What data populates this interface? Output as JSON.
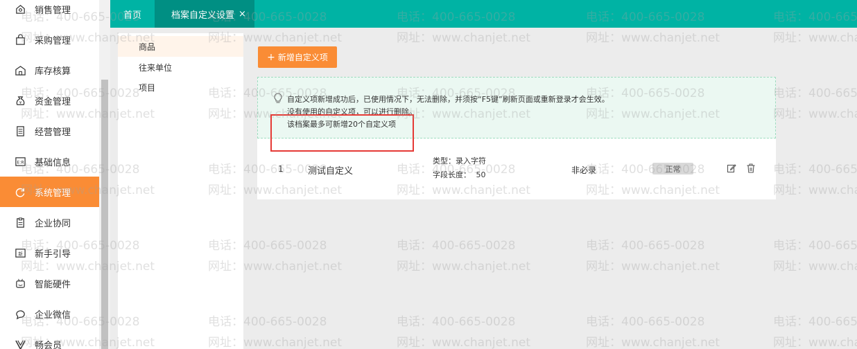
{
  "nav": {
    "items": [
      {
        "label": "销售管理",
        "icon": "sales-icon"
      },
      {
        "label": "采购管理",
        "icon": "purchase-bag-icon"
      },
      {
        "label": "库存核算",
        "icon": "warehouse-icon"
      },
      {
        "label": "资金管理",
        "icon": "money-bag-icon"
      },
      {
        "label": "经营管理",
        "icon": "document-list-icon"
      },
      {
        "label": "基础信息",
        "icon": "info-card-icon"
      },
      {
        "label": "系统管理",
        "icon": "system-refresh-icon"
      },
      {
        "label": "企业协同",
        "icon": "clipboard-icon"
      },
      {
        "label": "新手引导",
        "icon": "new-guide-icon"
      },
      {
        "label": "智能硬件",
        "icon": "robot-icon"
      },
      {
        "label": "企业微信",
        "icon": "chat-bubble-icon"
      },
      {
        "label": "畅会员",
        "icon": "member-v-icon"
      }
    ],
    "active_index": 6,
    "active_color": "#fa8c35"
  },
  "topbar": {
    "color": "#00b3a4",
    "tabs": [
      {
        "label": "首页"
      },
      {
        "label": "档案自定义设置",
        "close": "×"
      }
    ]
  },
  "category_menu": {
    "items": [
      {
        "label": "商品"
      },
      {
        "label": "往来单位"
      },
      {
        "label": "项目"
      }
    ],
    "active_index": 0
  },
  "add_button": {
    "plus": "+",
    "label": "新增自定义项"
  },
  "tip": {
    "icon": "lightbulb-icon",
    "lines": [
      "自定义项新增成功后，已使用情况下，无法删除，并须按“F5键”刷新页面或重新登录才会生效。",
      "没有使用的自定义项，可以进行删除。",
      "该档案最多可新增20个自定义项"
    ]
  },
  "rows": [
    {
      "index": "1",
      "name": "测试自定义",
      "type_text": "类型：录入字符",
      "length_text": "字段长度：",
      "length_value": "50",
      "required": "非必录",
      "status": "正常",
      "edit_icon": "edit-icon",
      "delete_icon": "trash-icon"
    }
  ],
  "watermark": {
    "phone": "电话：400-665-0028",
    "site": "网址：www.chanjet.net"
  }
}
